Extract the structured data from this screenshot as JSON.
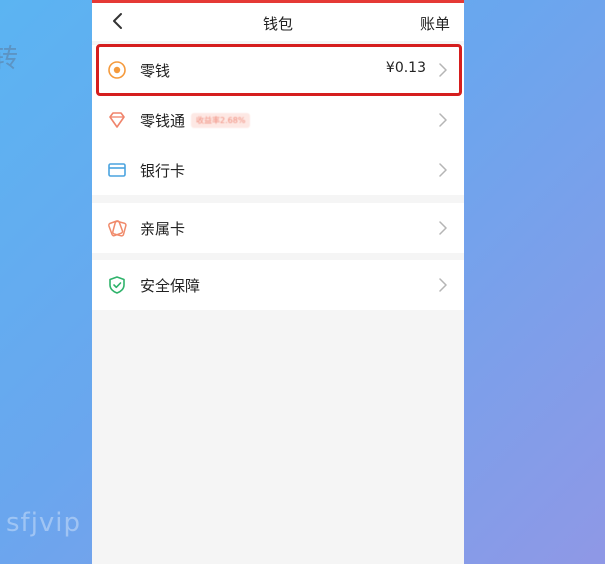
{
  "background": {
    "left_fragment": "转",
    "watermark": "sfjvip"
  },
  "nav": {
    "back_icon": "chevron-left-icon",
    "title": "钱包",
    "bill_label": "账单"
  },
  "rows": [
    {
      "label": "零钱",
      "amount": "¥0.13",
      "icon": "coin-icon",
      "color": "#f59a3c"
    },
    {
      "label": "零钱通",
      "badge": "收益率2.68%",
      "icon": "diamond-icon",
      "color": "#f0846b"
    },
    {
      "label": "银行卡",
      "icon": "bank-card-icon",
      "color": "#4aa3df"
    },
    {
      "label": "亲属卡",
      "icon": "family-card-icon",
      "color": "#f08a6a"
    },
    {
      "label": "安全保障",
      "icon": "shield-check-icon",
      "color": "#2fb36b"
    }
  ],
  "highlight_color": "#d51e1e"
}
